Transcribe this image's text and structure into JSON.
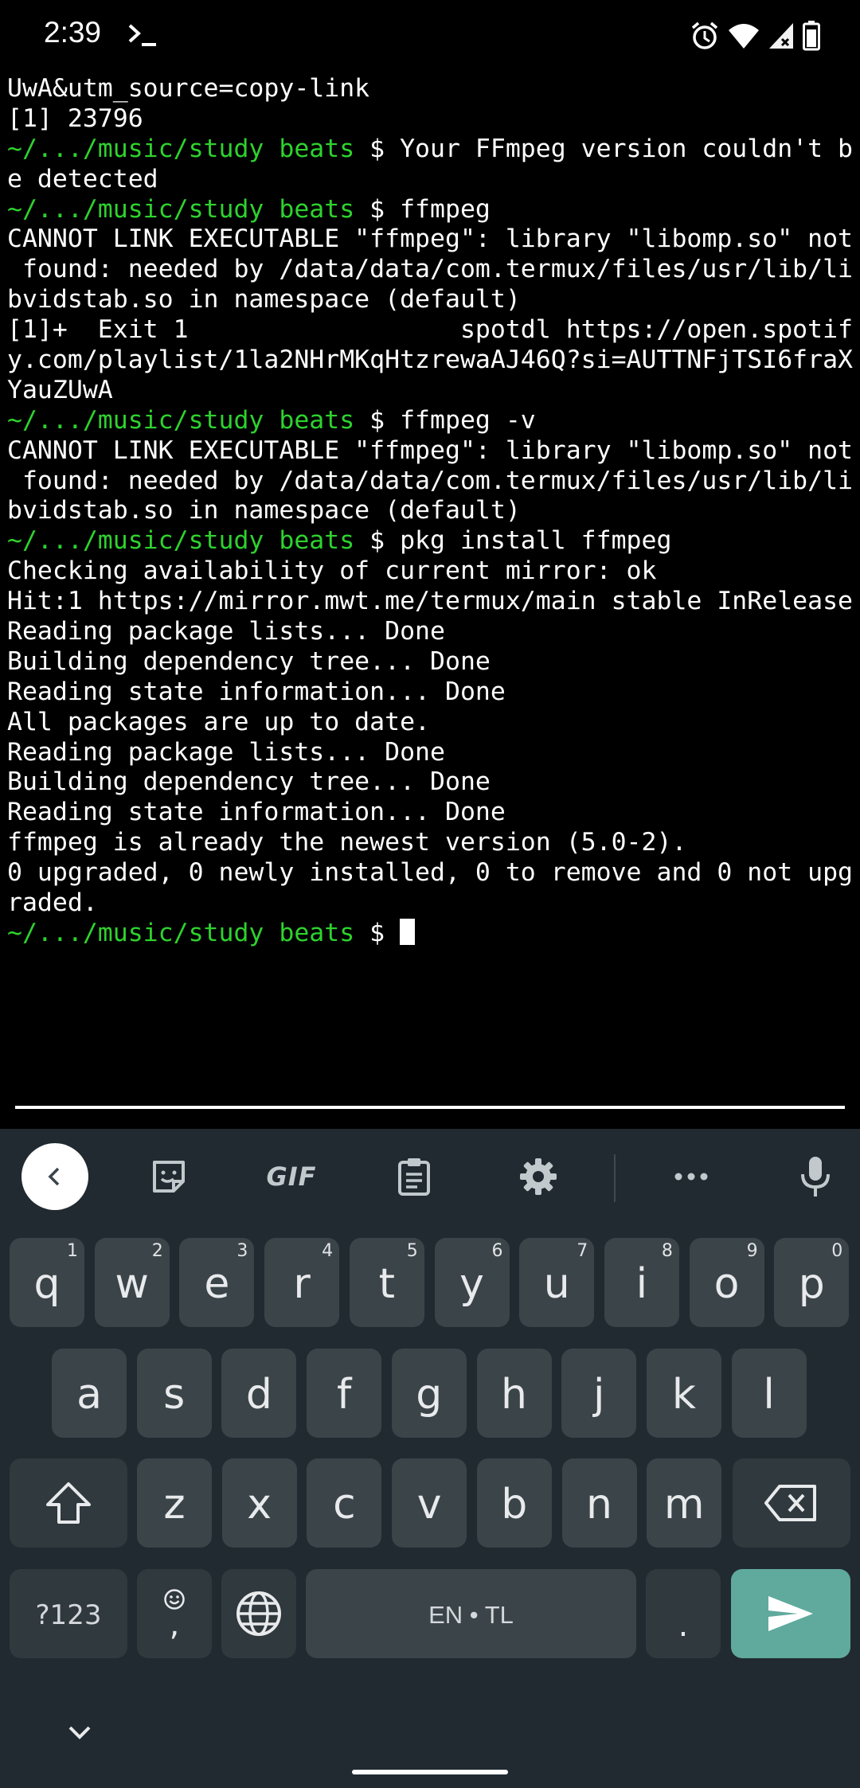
{
  "status_bar": {
    "time": "2:39",
    "icons": [
      "terminal-icon",
      "alarm-icon",
      "wifi-icon",
      "signal-icon",
      "battery-icon"
    ]
  },
  "terminal": {
    "prompt": "~/.../music/study beats",
    "prompt_color": "#2ed22e",
    "lines": [
      {
        "prompt": "",
        "text": "UwA&utm_source=copy-link"
      },
      {
        "prompt": "",
        "text": "[1] 23796"
      },
      {
        "prompt": "~/.../music/study beats",
        "text": " $ Your FFmpeg version couldn't b"
      },
      {
        "prompt": "",
        "text": "e detected"
      },
      {
        "prompt": "~/.../music/study beats",
        "text": " $ ffmpeg"
      },
      {
        "prompt": "",
        "text": "CANNOT LINK EXECUTABLE \"ffmpeg\": library \"libomp.so\" not"
      },
      {
        "prompt": "",
        "text": " found: needed by /data/data/com.termux/files/usr/lib/li"
      },
      {
        "prompt": "",
        "text": "bvidstab.so in namespace (default)"
      },
      {
        "prompt": "",
        "text": "[1]+  Exit 1                  spotdl https://open.spotif"
      },
      {
        "prompt": "",
        "text": "y.com/playlist/1la2NHrMKqHtzrewaAJ46Q?si=AUTTNFjTSI6fraX"
      },
      {
        "prompt": "",
        "text": "YauZUwA"
      },
      {
        "prompt": "~/.../music/study beats",
        "text": " $ ffmpeg -v"
      },
      {
        "prompt": "",
        "text": "CANNOT LINK EXECUTABLE \"ffmpeg\": library \"libomp.so\" not"
      },
      {
        "prompt": "",
        "text": " found: needed by /data/data/com.termux/files/usr/lib/li"
      },
      {
        "prompt": "",
        "text": "bvidstab.so in namespace (default)"
      },
      {
        "prompt": "~/.../music/study beats",
        "text": " $ pkg install ffmpeg"
      },
      {
        "prompt": "",
        "text": "Checking availability of current mirror: ok"
      },
      {
        "prompt": "",
        "text": "Hit:1 https://mirror.mwt.me/termux/main stable InRelease"
      },
      {
        "prompt": "",
        "text": "Reading package lists... Done"
      },
      {
        "prompt": "",
        "text": "Building dependency tree... Done"
      },
      {
        "prompt": "",
        "text": "Reading state information... Done"
      },
      {
        "prompt": "",
        "text": "All packages are up to date."
      },
      {
        "prompt": "",
        "text": "Reading package lists... Done"
      },
      {
        "prompt": "",
        "text": "Building dependency tree... Done"
      },
      {
        "prompt": "",
        "text": "Reading state information... Done"
      },
      {
        "prompt": "",
        "text": "ffmpeg is already the newest version (5.0-2)."
      },
      {
        "prompt": "",
        "text": "0 upgraded, 0 newly installed, 0 to remove and 0 not upg"
      },
      {
        "prompt": "",
        "text": "raded."
      },
      {
        "prompt": "~/.../music/study beats",
        "text": " $ ",
        "cursor": true
      }
    ]
  },
  "keyboard": {
    "toolbar": {
      "gif_label": "GIF",
      "icons": [
        "back-icon",
        "sticker-icon",
        "clipboard-icon",
        "settings-icon",
        "more-icon",
        "microphone-icon"
      ]
    },
    "row1": [
      {
        "key": "q",
        "hint": "1"
      },
      {
        "key": "w",
        "hint": "2"
      },
      {
        "key": "e",
        "hint": "3"
      },
      {
        "key": "r",
        "hint": "4"
      },
      {
        "key": "t",
        "hint": "5"
      },
      {
        "key": "y",
        "hint": "6"
      },
      {
        "key": "u",
        "hint": "7"
      },
      {
        "key": "i",
        "hint": "8"
      },
      {
        "key": "o",
        "hint": "9"
      },
      {
        "key": "p",
        "hint": "0"
      }
    ],
    "row2": [
      "a",
      "s",
      "d",
      "f",
      "g",
      "h",
      "j",
      "k",
      "l"
    ],
    "row3": [
      "z",
      "x",
      "c",
      "v",
      "b",
      "n",
      "m"
    ],
    "symbols_label": "?123",
    "comma_label": ",",
    "space_label": "EN • TL",
    "period_label": ".",
    "accent_color": "#5faa9d",
    "key_color": "#3b4449",
    "background_color": "#202a30"
  }
}
